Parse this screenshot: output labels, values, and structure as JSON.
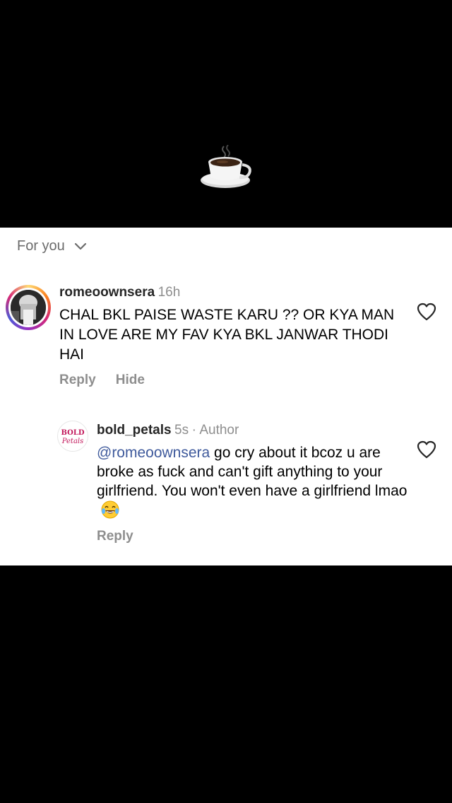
{
  "filter": {
    "label": "For you",
    "icon": "chevron-down-icon"
  },
  "top_media": {
    "emoji": "coffee-cup-icon"
  },
  "comments": [
    {
      "username": "romeoownsera",
      "time": "16h",
      "text": "CHAL BKL PAISE WASTE KARU ?? OR KYA MAN IN LOVE ARE MY FAV KYA BKL JANWAR THODI HAI",
      "reply_label": "Reply",
      "hide_label": "Hide",
      "like_icon": "heart-outline-icon"
    },
    {
      "username": "bold_petals",
      "time": "5s",
      "separator": "·",
      "author_label": "Author",
      "mention": "@romeoownsera",
      "text": " go cry about it bcoz u are broke as fuck and can't gift anything to your girlfriend. You won't even have a girlfriend lmao",
      "emoji": "laughing-tears-emoji",
      "reply_label": "Reply",
      "like_icon": "heart-outline-icon",
      "avatar_text": "BOLD Petals"
    }
  ],
  "colors": {
    "background": "#000000",
    "panel": "#ffffff",
    "mention": "#3f5a9c",
    "meta": "#8e8e8e"
  }
}
